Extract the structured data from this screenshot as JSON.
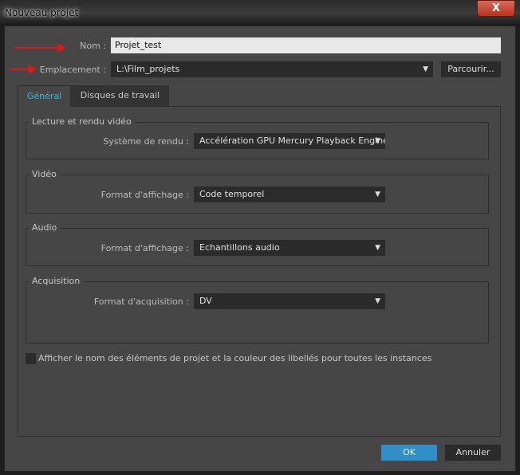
{
  "window": {
    "title": "Nouveau projet",
    "close": "X"
  },
  "nom": {
    "label": "Nom :",
    "value": "Projet_test"
  },
  "emplacement": {
    "label": "Emplacement :",
    "value": "L:\\Film_projets",
    "browse": "Parcourir..."
  },
  "tabs": [
    {
      "label": "Général",
      "active": true
    },
    {
      "label": "Disques de travail",
      "active": false
    }
  ],
  "groups": {
    "lecture": {
      "title": "Lecture et rendu vidéo",
      "label": "Système de rendu :",
      "value": "Accélération GPU Mercury Playback Engine"
    },
    "video": {
      "title": "Vidéo",
      "label": "Format d'affichage :",
      "value": "Code temporel"
    },
    "audio": {
      "title": "Audio",
      "label": "Format d'affichage :",
      "value": "Echantillons audio"
    },
    "acquisition": {
      "title": "Acquisition",
      "label": "Format d'acquisition :",
      "value": "DV"
    }
  },
  "checkbox": {
    "label": "Afficher le nom des éléments de projet et la couleur des libellés pour toutes les instances",
    "checked": false
  },
  "buttons": {
    "ok": "OK",
    "cancel": "Annuler"
  },
  "colors": {
    "accent": "#2f8fc6",
    "tab_active": "#3fb6e0",
    "annotation": "#e01818"
  }
}
